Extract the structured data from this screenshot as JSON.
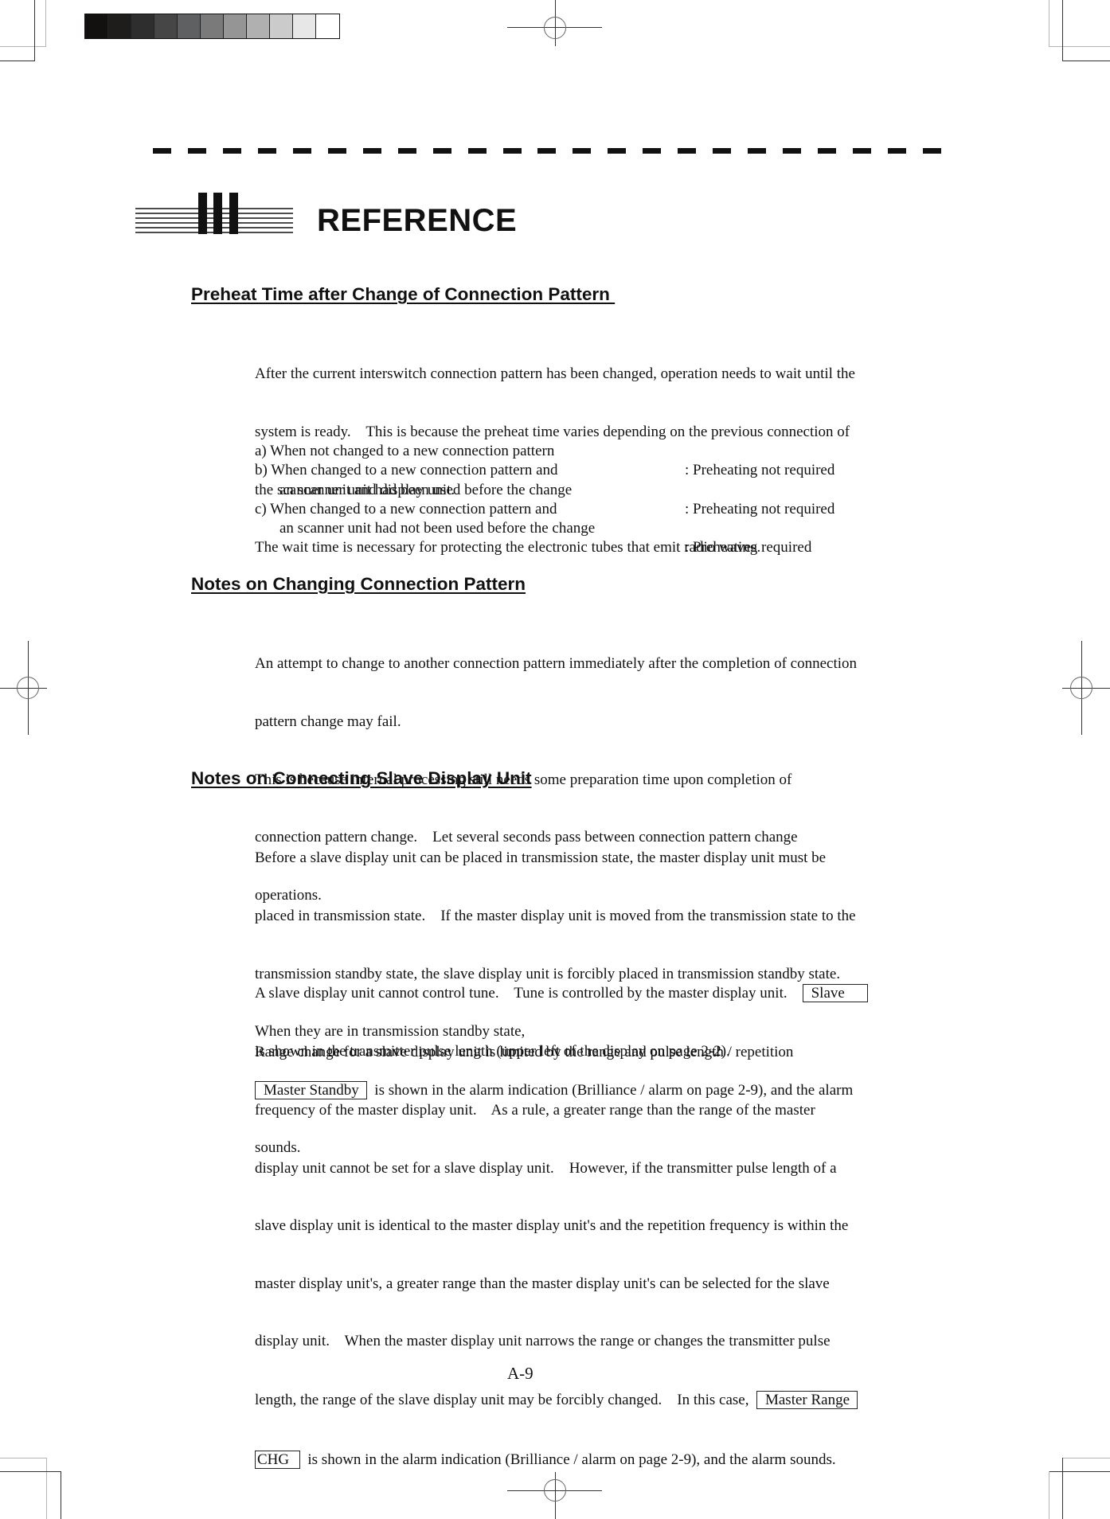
{
  "print_marks": {
    "gray_scale_swatches": [
      "#121110",
      "#1e1d1b",
      "#2e2e2e",
      "#464646",
      "#5f6062",
      "#7a7a7a",
      "#959595",
      "#b0b0b0",
      "#cbcbcb",
      "#e7e7e7",
      "#ffffff"
    ]
  },
  "chapter": {
    "number_icon": "roman-numeral-three-icon",
    "title": "REFERENCE"
  },
  "sections": [
    {
      "heading": "Preheat Time after Change of Connection Pattern ",
      "paragraph_lines": [
        "After the current interswitch connection pattern has been changed, operation needs to wait until the",
        "system is ready.    This is because the preheat time varies depending on the previous connection of",
        "the scanner unit and display unit.",
        "The wait time is necessary for protecting the electronic tubes that emit radio waves."
      ],
      "list": [
        {
          "condition": [
            "a) When not changed to a new connection pattern"
          ],
          "result": ": Preheating not required"
        },
        {
          "condition": [
            "b) When changed to a new connection pattern and",
            "an scanner unit had been used before the change"
          ],
          "result": ": Preheating not required"
        },
        {
          "condition": [
            "c) When changed to a new connection pattern and",
            "an scanner unit had not been used before the change"
          ],
          "result": ": Preheating required"
        }
      ]
    },
    {
      "heading": "Notes on Changing Connection Pattern",
      "paragraph_lines": [
        "An attempt to change to another connection pattern immediately after the completion of connection",
        "pattern change may fail.",
        "This is because internal processing still needs some preparation time upon completion of",
        "connection pattern change.    Let several seconds pass between connection pattern change",
        "operations."
      ]
    },
    {
      "heading": "Notes on Connecting Slave Display Unit",
      "para1_lines": [
        "Before a slave display unit can be placed in transmission state, the master display unit must be",
        "placed in transmission state.    If the master display unit is moved from the transmission state to the",
        "transmission standby state, the slave display unit is forcibly placed in transmission standby state.",
        "When they are in transmission standby state,"
      ],
      "para1_box": "Master Standby",
      "para1_after_box": "  is shown in the alarm indication (Brilliance / alarm on page 2-9), and the alarm",
      "para1_last": "sounds.",
      "para2_line1": "A slave display unit cannot control tune.    Tune is controlled by the master display unit.    ",
      "para2_box": "Slave    ",
      "para2_line2": "is shown in the transmitter pulse length (upper left of the display on page 2-2).",
      "para3_lines": [
        "Range change for a slave display unit is limited by the range and pulse length / repetition",
        "frequency of the master display unit.    As a rule, a greater range than the range of the master",
        "display unit cannot be set for a slave display unit.    However, if the transmitter pulse length of a",
        "slave display unit is identical to the master display unit's and the repetition frequency is within the",
        "master display unit's, a greater range than the master display unit's can be selected for the slave",
        "display unit.    When the master display unit narrows the range or changes the transmitter pulse"
      ],
      "para3_line7_before": "length, the range of the slave display unit may be forcibly changed.    In this case,  ",
      "para3_box_part1": "Master Range",
      "para3_box_part2": "CHG ",
      "para3_line8_after": "  is shown in the alarm indication (Brilliance / alarm on page 2-9), and the alarm sounds."
    }
  ],
  "footer": {
    "page_number": "A-9"
  }
}
